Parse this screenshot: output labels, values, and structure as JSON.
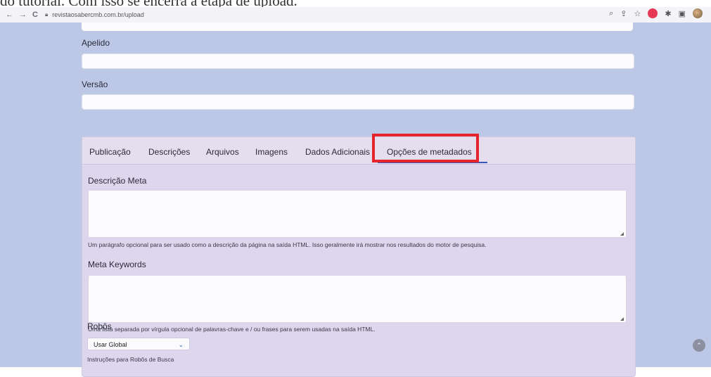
{
  "caption": "do tutorial. Com isso se encerra a etapa de upload.",
  "browser": {
    "back": "←",
    "forward": "→",
    "reload": "C",
    "url": "revistaosabercmb.com.br/upload",
    "icons": [
      "search-icon",
      "share-icon",
      "star-icon",
      "extension-red-icon",
      "puzzle-icon",
      "sidepanel-icon",
      "profile-avatar-icon"
    ]
  },
  "form": {
    "apelido_label": "Apelido",
    "versao_label": "Versão"
  },
  "tabs": [
    {
      "label": "Publicação"
    },
    {
      "label": "Descrições"
    },
    {
      "label": "Arquivos"
    },
    {
      "label": "Imagens"
    },
    {
      "label": "Dados Adicionais"
    },
    {
      "label": "Opções de metadados"
    }
  ],
  "metadata": {
    "descricao_label": "Descrição Meta",
    "descricao_help": "Um parágrafo opcional para ser usado como a descrição da página na saída HTML. Isso geralmente irá mostrar nos resultados do motor de pesquisa.",
    "keywords_label": "Meta Keywords",
    "keywords_help": "Uma lista separada por vírgula opcional de palavras-chave e / ou frases para serem usadas na saída HTML.",
    "robots_label": "Robôs",
    "robots_selected": "Usar Global",
    "robots_help": "Instruções para Robôs de Busca"
  },
  "colors": {
    "highlight": "#e6242c",
    "accent": "#3657b8",
    "page_bg": "#bcc8e6"
  }
}
